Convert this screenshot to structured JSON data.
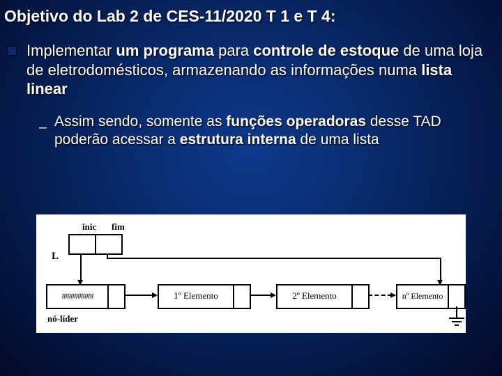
{
  "title": "Objetivo do Lab 2 de CES-11/2020 T 1 e T 4:",
  "bullet": {
    "pre": "Implementar ",
    "b1": "um programa",
    "mid1": " para ",
    "b2": "controle de estoque",
    "mid2": " de uma loja de eletrodomésticos, armazenando as informações numa ",
    "b3": "lista linear"
  },
  "sub": {
    "pre": "Assim sendo, somente as ",
    "b1": "funções operadoras",
    "mid1": " desse TAD poderão acessar a ",
    "b2": "estrutura interna",
    "post": " de uma lista"
  },
  "diagram": {
    "L": "L",
    "inic": "inic",
    "fim": "fim",
    "leaderFill": "#########",
    "leaderLabel": "nó-líder",
    "e1": "1º Elemento",
    "e2": "2º Elemento",
    "en": "nº Elemento"
  }
}
